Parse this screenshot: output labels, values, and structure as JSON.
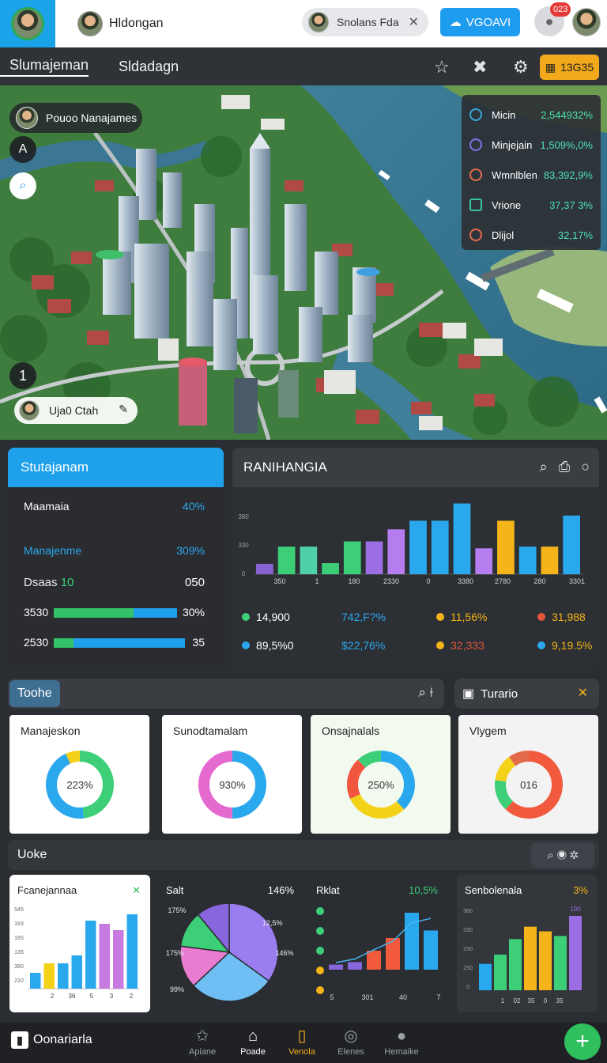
{
  "topbar": {
    "user_name": "Hldongan",
    "chip_label": "Snolans Fda",
    "cta_label": "VGOAVI",
    "badge": "023"
  },
  "nav": {
    "tab1": "Slumajeman",
    "tab2": "Sldadagn",
    "pill_label": "13G35"
  },
  "map": {
    "chip_label": "Pouoo  Nanajames",
    "btn_a": "A",
    "pin_label": "1",
    "user_label": "Uja0 Ctah",
    "stats": [
      {
        "label": "Micin",
        "value": "2,544932%",
        "color": "#39a6d6"
      },
      {
        "label": "Minjejain",
        "value": "1,509%,0%",
        "color": "#7a76e8"
      },
      {
        "label": "Wmnlblen",
        "value": "83,392,9%",
        "color": "#e46a4c"
      },
      {
        "label": "Vrione",
        "value": "37,37 3%",
        "color": "#38c89a"
      },
      {
        "label": "Dlijol",
        "value": "32,17%",
        "color": "#e46a4c"
      }
    ]
  },
  "left_card": {
    "title": "Stutajanam",
    "rows": [
      {
        "label": "Maamaia",
        "value": "40%"
      },
      {
        "label": "Manajenme",
        "value": "309%"
      },
      {
        "label": "Dsaas",
        "label_accent": "10",
        "value": "050"
      }
    ],
    "bars": [
      {
        "label": "3530",
        "value": "30%",
        "fraction": 0.65
      },
      {
        "label": "2530",
        "value": "35",
        "fraction": 0.15
      }
    ]
  },
  "chart_card": {
    "title": "RANIHANGIA",
    "legend": [
      {
        "value": "14,900",
        "color": "#3ccf78",
        "text_color": "#ffffff"
      },
      {
        "value": "742,F?%",
        "color": "",
        "text_color": "#2aa8ee"
      },
      {
        "value": "11,56%",
        "color": "#f4b41a",
        "text_color": "#f4b41a"
      },
      {
        "value": "31,988",
        "color": "#e4553e",
        "text_color": "#f4b41a"
      },
      {
        "value": "89,5%0",
        "color": "#2aa8ee",
        "text_color": "#ffffff"
      },
      {
        "value": "$22,76%",
        "color": "",
        "text_color": "#2aa8ee"
      },
      {
        "value": "32,333",
        "color": "#f4b41a",
        "text_color": "#e4553e"
      },
      {
        "value": "9,19.5%",
        "color": "#2aa8ee",
        "text_color": "#f4b41a"
      }
    ]
  },
  "chart_data": [
    {
      "type": "bar",
      "title": "RANIHANGIA",
      "y_ticks": [
        "380",
        "330",
        "0"
      ],
      "x_ticks": [
        "350",
        "1",
        "180",
        "2330",
        "0",
        "3380",
        "2780",
        "280",
        "3301"
      ],
      "values": [
        30,
        80,
        80,
        32,
        95,
        95,
        130,
        155,
        155,
        205,
        75,
        155,
        80,
        80,
        170
      ],
      "colors": [
        "#8a63d2",
        "#3ccf78",
        "#4fd0a8",
        "#3ccf78",
        "#3ccf78",
        "#9b6ee4",
        "#b57df0",
        "#2aa8ee",
        "#2aa8ee",
        "#2aa8ee",
        "#b57df0",
        "#f4b41a",
        "#2aa8ee",
        "#f4b41a",
        "#2aa8ee"
      ],
      "ylim": [
        0,
        220
      ]
    },
    {
      "type": "pie",
      "title": "Manajeskon",
      "center_label": "223%",
      "values": [
        0.48,
        0.45,
        0.07
      ],
      "colors": [
        "#3ccf78",
        "#2aa8ee",
        "#f4d21a"
      ]
    },
    {
      "type": "pie",
      "title": "Sunodtamalam",
      "center_label": "930%",
      "values": [
        0.5,
        0.5
      ],
      "colors": [
        "#2aa8ee",
        "#e46ad0"
      ]
    },
    {
      "type": "pie",
      "title": "Onsajnalals",
      "center_label": "250%",
      "values": [
        0.38,
        0.3,
        0.2,
        0.12
      ],
      "colors": [
        "#2aa8ee",
        "#f4d21a",
        "#f2553e",
        "#3ccf78"
      ]
    },
    {
      "type": "pie",
      "title": "Vlygem",
      "center_label": "016",
      "values": [
        0.62,
        0.15,
        0.13,
        0.1
      ],
      "colors": [
        "#f25a3e",
        "#3ccf78",
        "#f4d21a",
        "#e46a4c"
      ]
    },
    {
      "type": "bar",
      "title": "Fcanejannaa",
      "y_ticks": [
        "545",
        "183",
        "165",
        "135",
        "380",
        "210"
      ],
      "x_ticks": [
        "2",
        "36",
        "5",
        "3",
        "2"
      ],
      "values": [
        20,
        32,
        32,
        42,
        86,
        82,
        74,
        94
      ],
      "colors": [
        "#2aa8ee",
        "#f4d21a",
        "#2aa8ee",
        "#2aa8ee",
        "#2aa8ee",
        "#c77ae0",
        "#c77ae0",
        "#2aa8ee"
      ]
    },
    {
      "type": "pie",
      "title": "Salt",
      "value": "146%",
      "labels": [
        "175%",
        "175%",
        "12,5%",
        "146%",
        "99%"
      ],
      "values": [
        0.35,
        0.28,
        0.14,
        0.12,
        0.11
      ],
      "colors": [
        "#9a7ef0",
        "#6fbff4",
        "#e77cd1",
        "#3ccf78",
        "#8866dd"
      ]
    },
    {
      "type": "line",
      "title": "Rklat",
      "value": "10,5%",
      "x_ticks": [
        "5",
        "301",
        "40",
        "7"
      ],
      "values": [
        10,
        15,
        28,
        40,
        66,
        72
      ],
      "bars": [
        8,
        12,
        30,
        50,
        90,
        62
      ],
      "colors": [
        "#8866dd",
        "#8866dd",
        "#f25a3e",
        "#f25a3e",
        "#2aa8ee",
        "#2aa8ee"
      ],
      "dot_colors": [
        "#3ccf78",
        "#3ccf78",
        "#3ccf78",
        "#f4b41a",
        "#f4b41a"
      ]
    },
    {
      "type": "bar",
      "title": "Senbolenala",
      "value": "3%",
      "y_ticks": [
        "380",
        "330",
        "230",
        "250",
        "0"
      ],
      "x_ticks": [
        "1",
        "02",
        "35",
        "0",
        "35"
      ],
      "values": [
        34,
        46,
        66,
        82,
        76,
        70,
        96
      ],
      "colors": [
        "#2aa8ee",
        "#3ccf78",
        "#3ccf78",
        "#f4b41a",
        "#f4b41a",
        "#3ccf78",
        "#9b6ee4"
      ],
      "top_label": "190"
    }
  ],
  "toolbar1": {
    "tag": "Toohe",
    "tab": "Turario"
  },
  "toolbar2": {
    "tag": "Uoke"
  },
  "bottom_nav": {
    "brand": "Oonariarla",
    "items": [
      "Apiane",
      "Poade",
      "Venola",
      "Elenes",
      "Hemaike"
    ]
  }
}
